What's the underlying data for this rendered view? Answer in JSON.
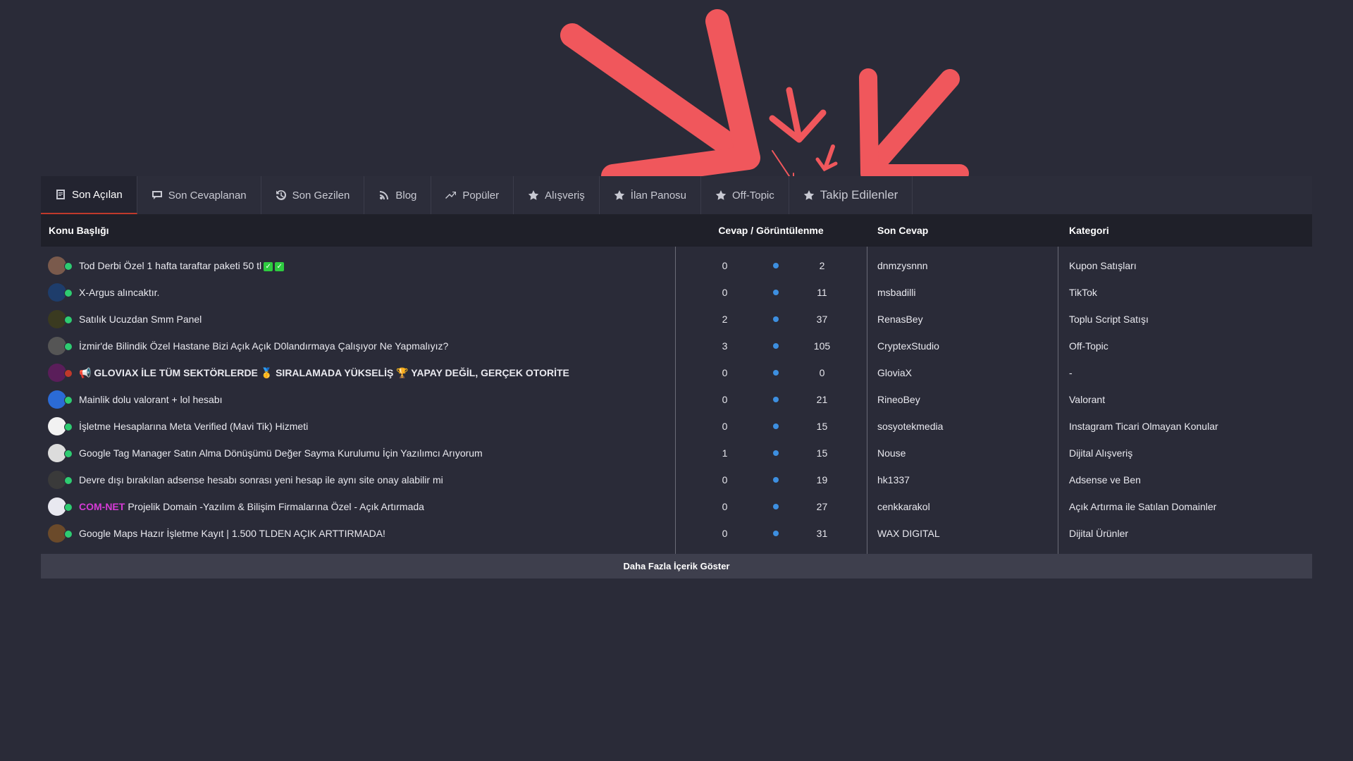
{
  "tabs": [
    {
      "label": "Son Açılan",
      "icon": "document-icon",
      "active": true
    },
    {
      "label": "Son Cevaplanan",
      "icon": "chat-icon",
      "active": false
    },
    {
      "label": "Son Gezilen",
      "icon": "history-icon",
      "active": false
    },
    {
      "label": "Blog",
      "icon": "rss-icon",
      "active": false
    },
    {
      "label": "Popüler",
      "icon": "trend-icon",
      "active": false
    },
    {
      "label": "Alışveriş",
      "icon": "star-icon",
      "active": false
    },
    {
      "label": "İlan Panosu",
      "icon": "star-icon",
      "active": false
    },
    {
      "label": "Off-Topic",
      "icon": "star-icon",
      "active": false
    },
    {
      "label": "Takip Edilenler",
      "icon": "star-icon",
      "active": false
    }
  ],
  "header": {
    "topic": "Konu Başlığı",
    "stats": "Cevap / Görüntülenme",
    "last": "Son Cevap",
    "category": "Kategori"
  },
  "rows": [
    {
      "title": "Tod Derbi Özel 1 hafta taraftar paketi 50 tl",
      "checks": true,
      "replies": "0",
      "views": "2",
      "last": "dnmzysnnn",
      "category": "Kupon Satışları",
      "avatar": "#7a5a4c"
    },
    {
      "title": "X-Argus alıncaktır.",
      "replies": "0",
      "views": "11",
      "last": "msbadilli",
      "category": "TikTok",
      "avatar": "#1e3d6b"
    },
    {
      "title": "Satılık Ucuzdan Smm Panel",
      "replies": "2",
      "views": "37",
      "last": "RenasBey",
      "category": "Toplu Script Satışı",
      "avatar": "#3a3a20"
    },
    {
      "title": "İzmir'de Bilindik Özel Hastane Bizi Açık Açık D0landırmaya Çalışıyor Ne Yapmalıyız?",
      "replies": "3",
      "views": "105",
      "last": "CryptexStudio",
      "category": "Off-Topic",
      "avatar": "#555"
    },
    {
      "title": "📢 GLOVIAX İLE TÜM SEKTÖRLERDE 🥇 SIRALAMADA YÜKSELİŞ 🏆 YAPAY DEĞİL, GERÇEK OTORİTE",
      "bold": true,
      "offline": true,
      "replies": "0",
      "views": "0",
      "last": "GloviaX",
      "category": "-",
      "avatar": "#5a1e5a"
    },
    {
      "title": "Mainlik dolu valorant + lol hesabı",
      "replies": "0",
      "views": "21",
      "last": "RineoBey",
      "category": "Valorant",
      "avatar": "#2b6bd6"
    },
    {
      "title": "İşletme Hesaplarına Meta Verified (Mavi Tik) Hizmeti",
      "replies": "0",
      "views": "15",
      "last": "sosyotekmedia",
      "category": "Instagram Ticari Olmayan Konular",
      "avatar": "#f2f2f2"
    },
    {
      "title": "Google Tag Manager Satın Alma Dönüşümü Değer Sayma Kurulumu İçin Yazılımcı Arıyorum",
      "replies": "1",
      "views": "15",
      "last": "Nouse",
      "category": "Dijital Alışveriş",
      "avatar": "#dcdcdc"
    },
    {
      "title": "Devre dışı bırakılan adsense hesabı sonrası yeni hesap ile aynı site onay alabilir mi",
      "replies": "0",
      "views": "19",
      "last": "hk1337",
      "category": "Adsense ve Ben",
      "avatar": "#3a3a3a"
    },
    {
      "prefix": "COM-NET",
      "title": "Projelik Domain -Yazılım & Bilişim Firmalarına Özel - Açık Artırmada",
      "replies": "0",
      "views": "27",
      "last": "cenkkarakol",
      "category": "Açık Artırma ile Satılan Domainler",
      "avatar": "#e8e8f0"
    },
    {
      "title": "Google Maps Hazır İşletme Kayıt | 1.500 TLDEN AÇIK ARTTIRMADA!",
      "replies": "0",
      "views": "31",
      "last": "WAX DIGITAL",
      "category": "Dijital Ürünler",
      "avatar": "#6b4a2a"
    }
  ],
  "more_label": "Daha Fazla İçerik Göster",
  "colors": {
    "background": "#2a2b38",
    "accent": "#c0392b",
    "arrow": "#f0575c",
    "online": "#2ecc71",
    "dot": "#3d8fe0"
  }
}
